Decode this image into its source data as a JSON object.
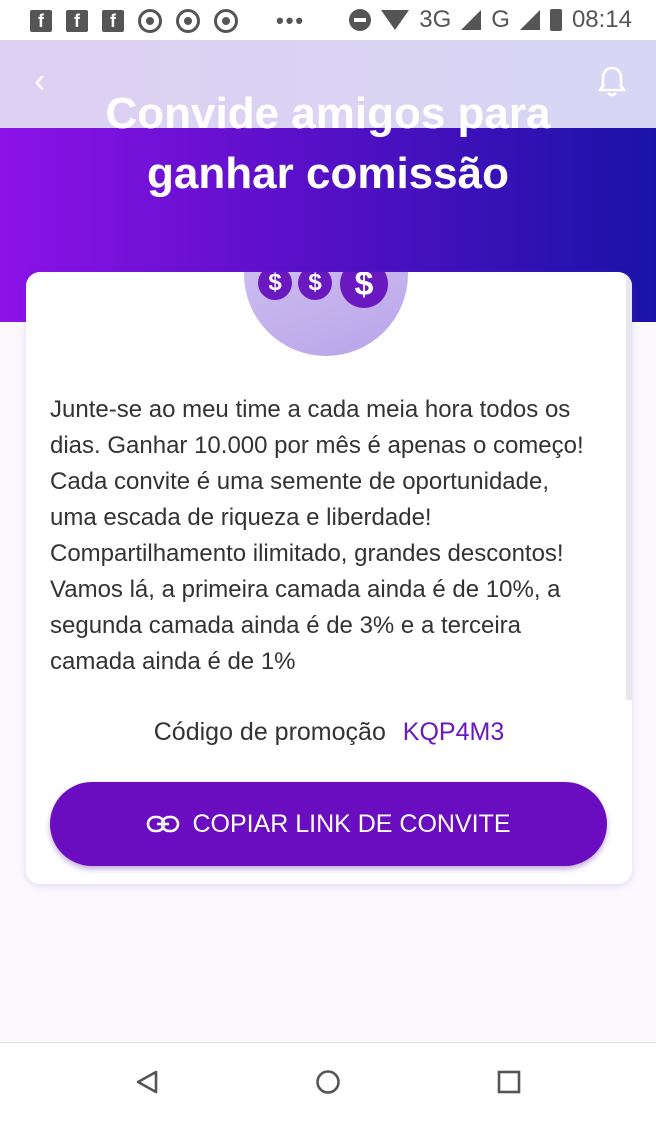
{
  "status_bar": {
    "network": "3G",
    "network2": "G",
    "time": "08:14",
    "icons": [
      "facebook-icon",
      "facebook-icon",
      "facebook-icon",
      "chrome-icon",
      "chrome-icon",
      "chrome-icon",
      "more-dots-icon",
      "do-not-disturb-icon",
      "wifi-icon",
      "signal-icon",
      "battery-icon"
    ]
  },
  "header": {
    "title_line1": "Convide amigos para",
    "title_line2": "ganhar comissão",
    "back_icon": "chevron-left-icon",
    "bell_icon": "bell-icon"
  },
  "card": {
    "coin_symbol": "$",
    "description": "Junte-se ao meu time a cada meia hora todos os dias. Ganhar 10.000 por mês é apenas o começo! Cada convite é uma semente de oportunidade, uma escada de riqueza e liberdade! Compartilhamento ilimitado, grandes descontos! Vamos lá, a primeira camada ainda é de 10%, a segunda camada ainda é de 3% e a terceira camada ainda é de 1%",
    "promo_label": "Código de promoção",
    "promo_code": "KQP4M3",
    "copy_button": "COPIAR LINK DE CONVITE"
  },
  "colors": {
    "primary": "#6a0cbf",
    "gradient_start": "#8d12e8",
    "gradient_end": "#1a12a8"
  },
  "nav_bar": [
    "back-triangle-icon",
    "home-circle-icon",
    "recents-square-icon"
  ]
}
